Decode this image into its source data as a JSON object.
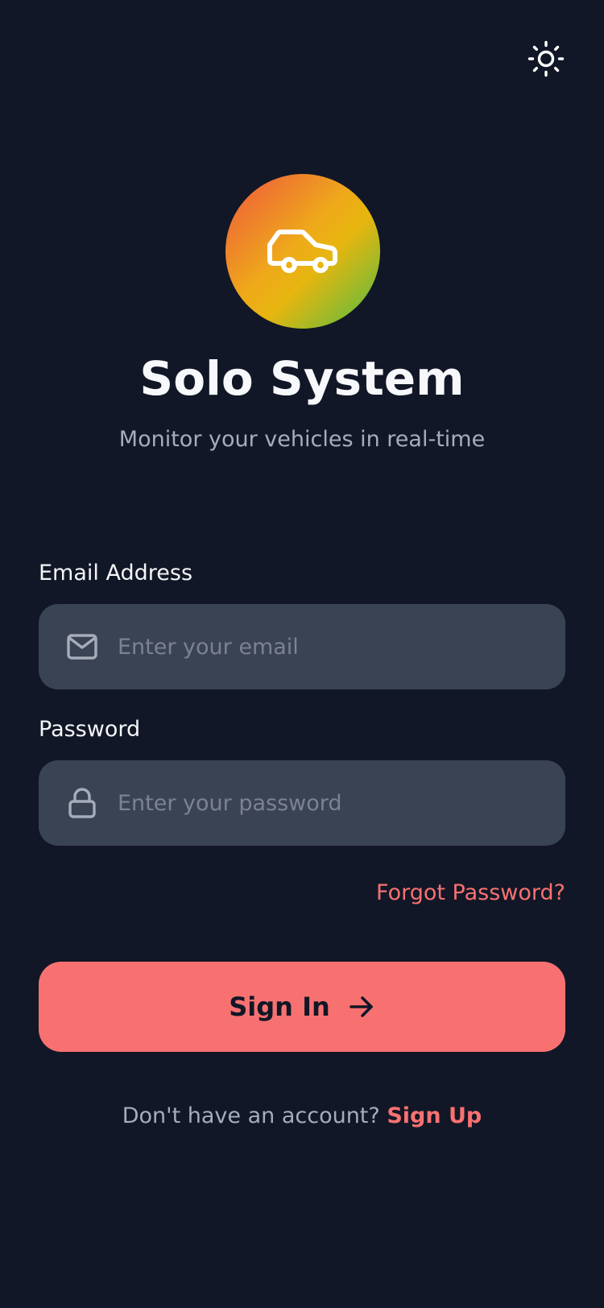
{
  "app": {
    "title": "Solo System",
    "subtitle": "Monitor your vehicles in real-time"
  },
  "theme_toggle": {
    "icon": "sun-icon"
  },
  "logo": {
    "icon": "car-icon"
  },
  "form": {
    "email_label": "Email Address",
    "email_placeholder": "Enter your email",
    "email_value": "",
    "email_icon": "mail-icon",
    "password_label": "Password",
    "password_placeholder": "Enter your password",
    "password_value": "",
    "password_icon": "lock-icon",
    "forgot_password": "Forgot Password?",
    "sign_in_label": "Sign In",
    "sign_in_icon": "arrow-right-icon"
  },
  "footer": {
    "prompt": "Don't have an account?",
    "sign_up_label": "Sign Up"
  },
  "colors": {
    "background": "#111726",
    "input_background": "#3a4354",
    "accent": "#f87171",
    "muted_text": "#a6adba",
    "placeholder": "#7b8291"
  }
}
